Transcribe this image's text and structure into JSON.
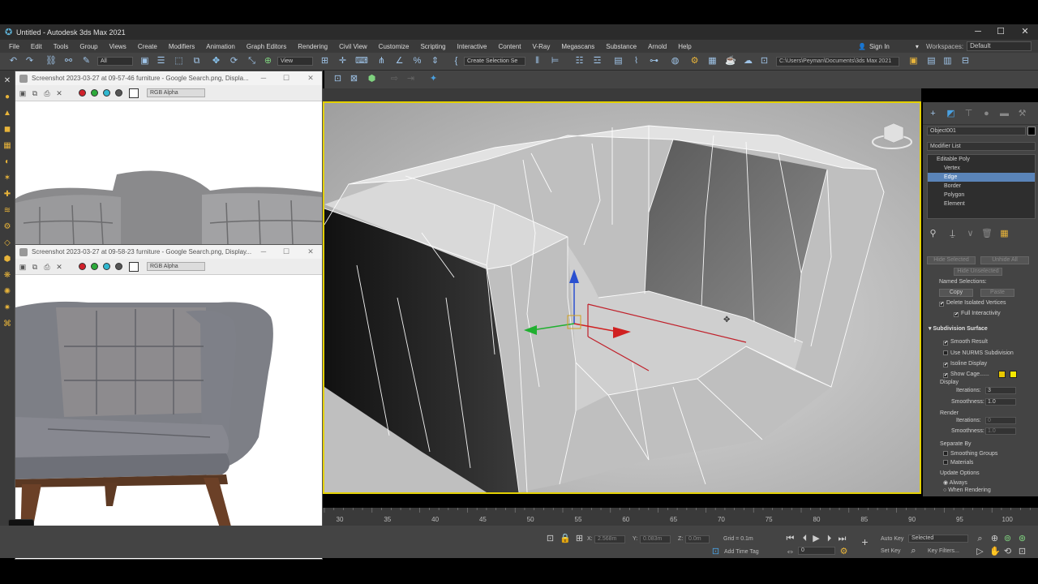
{
  "window": {
    "title": "Untitled - Autodesk 3ds Max 2021",
    "icon": "3ds-max-logo-icon",
    "min": "─",
    "max": "☐",
    "close": "✕"
  },
  "menu": [
    "File",
    "Edit",
    "Tools",
    "Group",
    "Views",
    "Create",
    "Modifiers",
    "Animation",
    "Graph Editors",
    "Rendering",
    "Civil View",
    "Customize",
    "Scripting",
    "Interactive",
    "Content",
    "V-Ray",
    "Megascans",
    "Substance",
    "Arnold",
    "Help"
  ],
  "signin": {
    "label": "Sign In",
    "icon": "user-icon"
  },
  "workspaces": {
    "label": "Workspaces:",
    "value": "Default"
  },
  "toolbar": {
    "selection_filter": "All",
    "ref_coord": "View",
    "named_selection": "Create Selection Se",
    "project_path": "C:\\Users\\Peyman\\Documents\\3ds Max 2021"
  },
  "viewer1": {
    "title": "Screenshot 2023-03-27 at 09-57-46 furniture - Google Search.png, Displa...",
    "channel": "RGB Alpha"
  },
  "viewer2": {
    "title": "Screenshot 2023-03-27 at 09-58-23 furniture - Google Search.png, Display...",
    "channel": "RGB Alpha"
  },
  "cmdpanel": {
    "object_name": "Object001",
    "modifier_list": "Modifier List",
    "stack": [
      {
        "label": "Editable Poly",
        "selected": false,
        "top": true
      },
      {
        "label": "Vertex",
        "selected": false
      },
      {
        "label": "Edge",
        "selected": true
      },
      {
        "label": "Border",
        "selected": false
      },
      {
        "label": "Polygon",
        "selected": false
      },
      {
        "label": "Element",
        "selected": false
      }
    ],
    "hide_selected": "Hide Selected",
    "unhide_all": "Unhide All",
    "hide_unselected": "Hide Unselected",
    "named_selections": "Named Selections:",
    "copy": "Copy",
    "paste": "Paste",
    "delete_isolated": "Delete Isolated Vertices",
    "full_interactivity": "Full Interactivity",
    "subdiv": {
      "title": "Subdivision Surface",
      "smooth_result": "Smooth Result",
      "use_nurms": "Use NURMS Subdivision",
      "isoline": "Isoline Display",
      "show_cage": "Show Cage......",
      "display": "Display",
      "iterations_label": "Iterations:",
      "iterations": "3",
      "smoothness_label": "Smoothness:",
      "smoothness": "1.0",
      "render": "Render",
      "r_iterations_label": "Iterations:",
      "r_iterations": "0",
      "r_smoothness_label": "Smoothness:",
      "r_smoothness": "1.0",
      "separate_by": "Separate By",
      "smoothing_groups": "Smoothing Groups",
      "materials": "Materials",
      "update_options": "Update Options",
      "always": "Always",
      "when_rendering": "When Rendering"
    },
    "colors": {
      "cage1": "#e8c800",
      "cage2": "#f5e800"
    }
  },
  "timeline": {
    "ticks": [
      "30",
      "35",
      "40",
      "45",
      "50",
      "55",
      "60",
      "65",
      "70",
      "75",
      "80",
      "85",
      "90",
      "95",
      "100"
    ]
  },
  "status": {
    "x_label": "X:",
    "x": "2.568m",
    "y_label": "Y:",
    "y": "0.083m",
    "z_label": "Z:",
    "z": "0.0m",
    "grid": "Grid = 0.1m",
    "add_time_tag": "Add Time Tag",
    "auto_key": "Auto Key",
    "selected": "Selected",
    "set_key": "Set Key",
    "key_filters": "Key Filters...",
    "frame": "0"
  }
}
